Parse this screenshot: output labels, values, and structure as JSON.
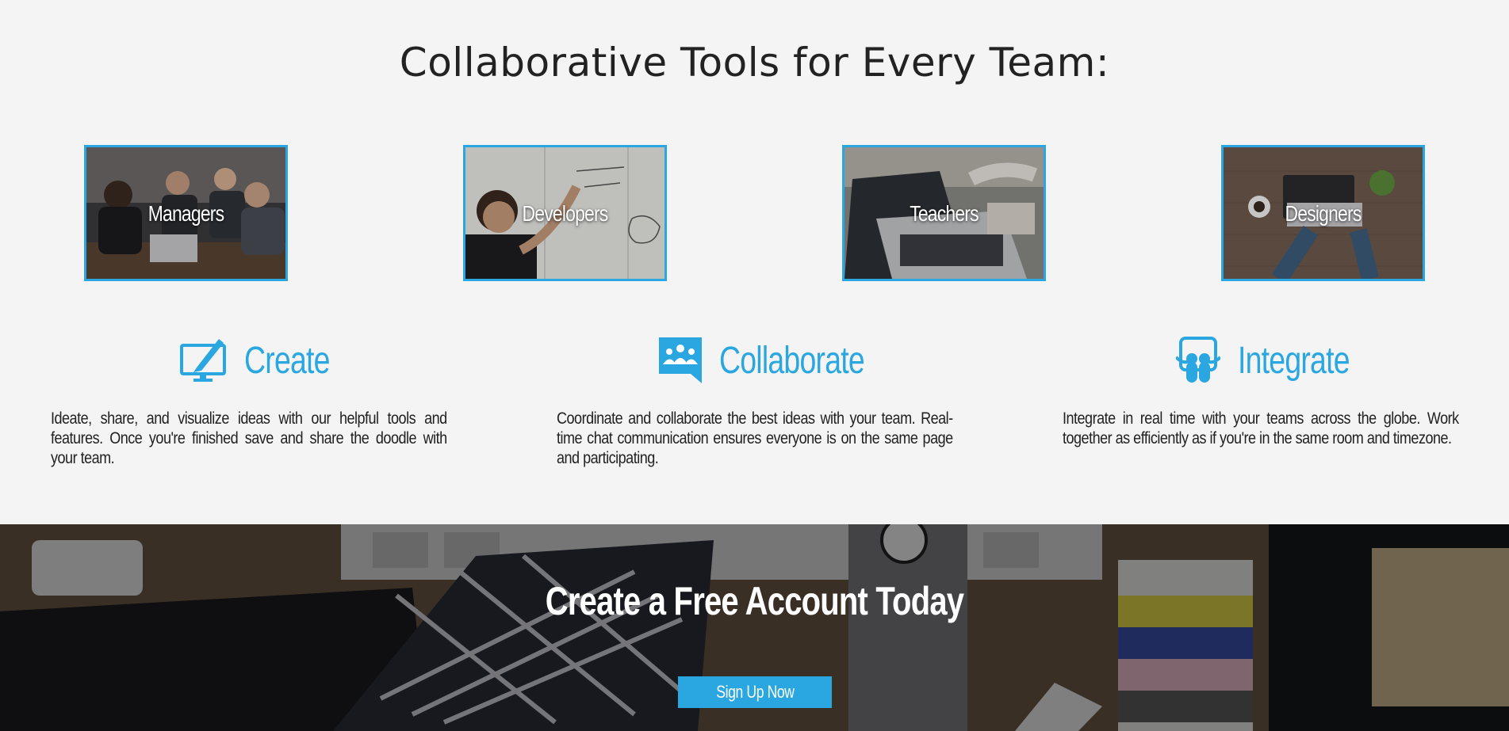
{
  "page": {
    "title": "Collaborative Tools for Every Team:"
  },
  "audiences": [
    {
      "label": "Managers"
    },
    {
      "label": "Developers"
    },
    {
      "label": "Teachers"
    },
    {
      "label": "Designers"
    }
  ],
  "features": [
    {
      "title": "Create",
      "icon": "monitor-pen-icon",
      "text": "Ideate, share, and visualize ideas with our helpful tools and features. Once you're finished save and share the doodle with your team."
    },
    {
      "title": "Collaborate",
      "icon": "group-chat-icon",
      "text": "Coordinate and collaborate the best ideas with your team. Real-time chat communication ensures everyone is on the same page and participating."
    },
    {
      "title": "Integrate",
      "icon": "slideshare-icon",
      "text": "Integrate in real time with your teams across the globe. Work together as efficiently as if you're in the same room and timezone."
    }
  ],
  "cta": {
    "title": "Create a Free Account Today",
    "button_label": "Sign Up Now"
  },
  "colors": {
    "accent": "#2aa6e0",
    "background": "#f4f4f4",
    "text": "#222222"
  }
}
